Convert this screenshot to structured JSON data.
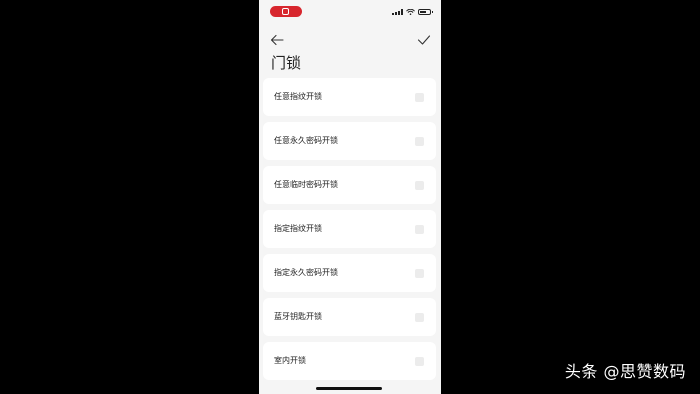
{
  "page": {
    "title": "门锁"
  },
  "options": [
    {
      "label": "任意指纹开锁",
      "checked": false
    },
    {
      "label": "任意永久密码开锁",
      "checked": false
    },
    {
      "label": "任意临时密码开锁",
      "checked": false
    },
    {
      "label": "指定指纹开锁",
      "checked": false
    },
    {
      "label": "指定永久密码开锁",
      "checked": false
    },
    {
      "label": "蓝牙钥匙开锁",
      "checked": false
    },
    {
      "label": "室内开锁",
      "checked": false
    }
  ],
  "nav": {
    "back_icon": "arrow-left-icon",
    "confirm_icon": "checkmark-icon"
  },
  "watermark": {
    "text": "头条 @思赞数码"
  },
  "colors": {
    "background": "#000000",
    "screen": "#f5f5f5",
    "card": "#ffffff",
    "recording_pill": "#d7262d"
  }
}
